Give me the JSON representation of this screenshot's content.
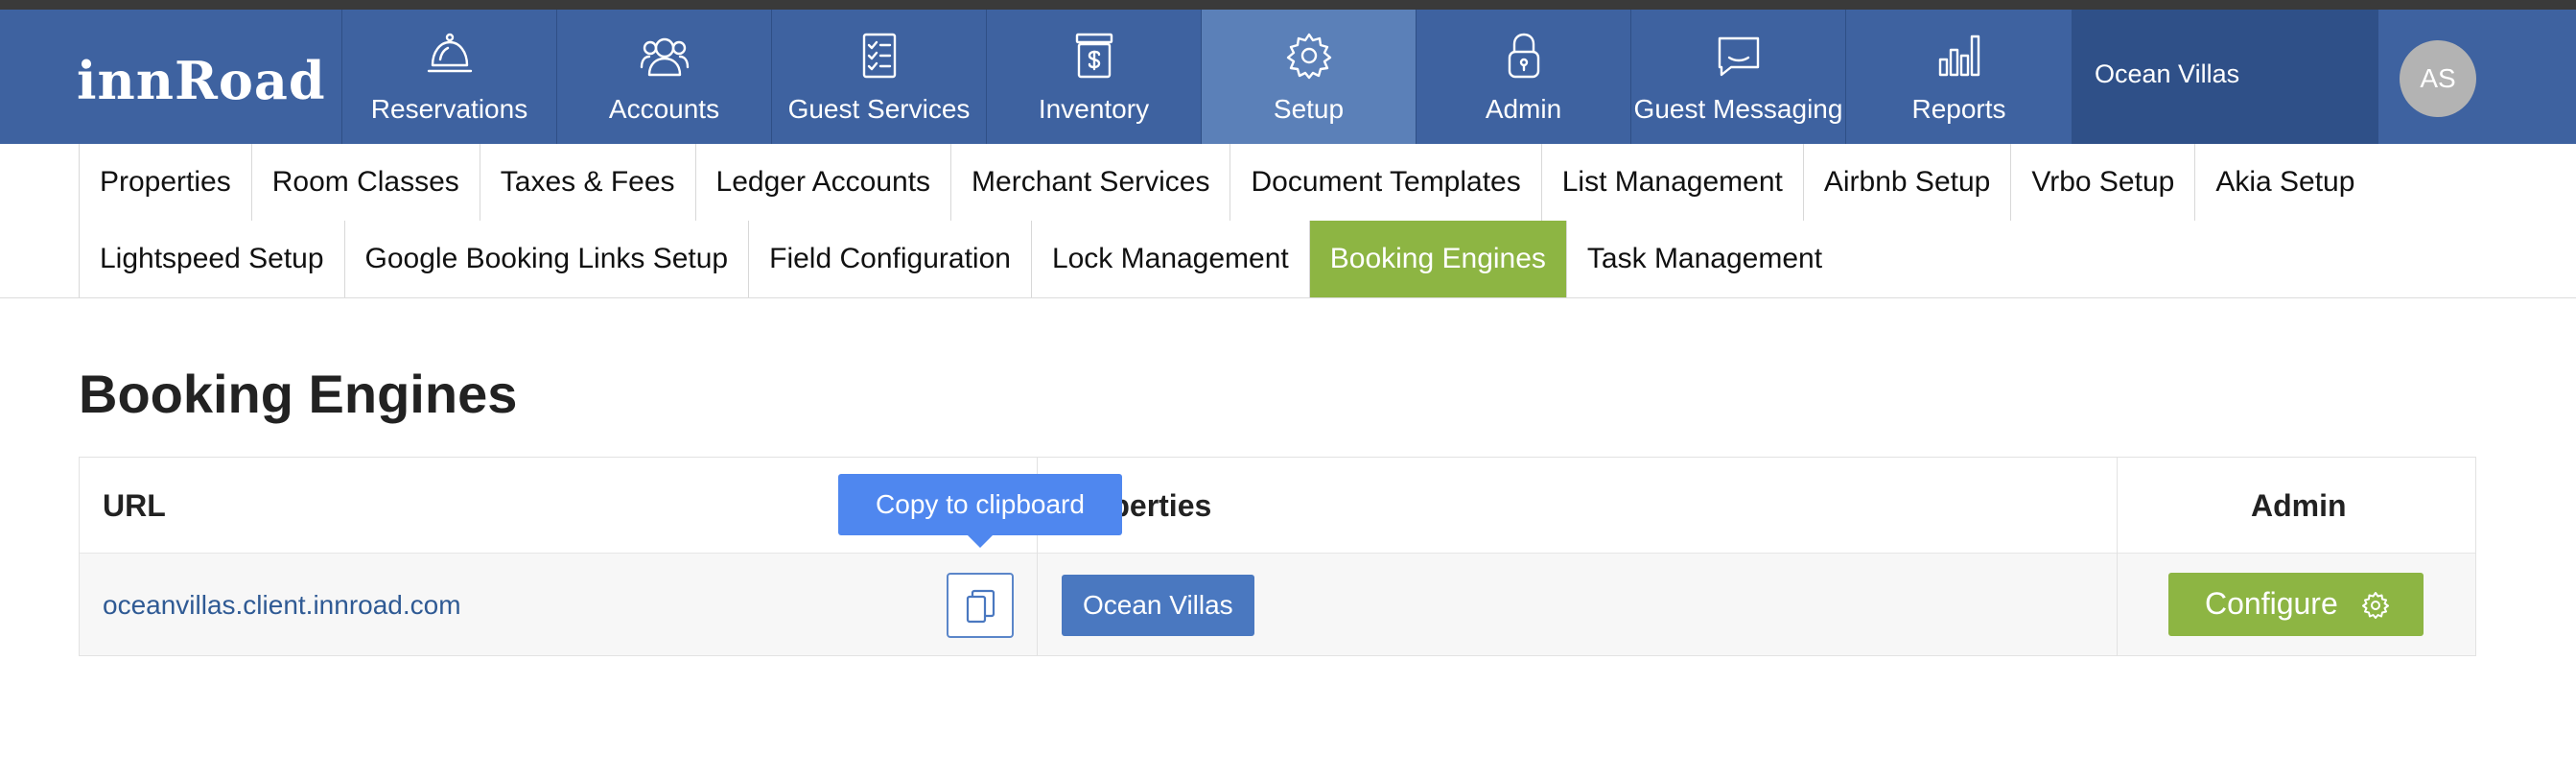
{
  "app": {
    "logo": "innRoad"
  },
  "nav": {
    "items": [
      {
        "label": "Reservations",
        "icon": "bell-icon"
      },
      {
        "label": "Accounts",
        "icon": "users-icon"
      },
      {
        "label": "Guest Services",
        "icon": "checklist-icon"
      },
      {
        "label": "Inventory",
        "icon": "inventory-icon"
      },
      {
        "label": "Setup",
        "icon": "gear-icon",
        "active": true
      },
      {
        "label": "Admin",
        "icon": "lock-icon"
      },
      {
        "label": "Guest Messaging",
        "icon": "message-icon"
      },
      {
        "label": "Reports",
        "icon": "bar-chart-icon"
      }
    ],
    "property": "Ocean Villas",
    "avatar": "AS"
  },
  "subnav": {
    "row1": [
      "Properties",
      "Room Classes",
      "Taxes & Fees",
      "Ledger Accounts",
      "Merchant Services",
      "Document Templates",
      "List Management",
      "Airbnb Setup",
      "Vrbo Setup",
      "Akia Setup"
    ],
    "row2": [
      "Lightspeed Setup",
      "Google Booking Links Setup",
      "Field Configuration",
      "Lock Management",
      "Booking Engines",
      "Task Management"
    ],
    "active": "Booking Engines"
  },
  "page": {
    "title": "Booking Engines"
  },
  "table": {
    "headers": {
      "url": "URL",
      "properties": "Properties",
      "admin": "Admin"
    },
    "rows": [
      {
        "url": "oceanvillas.client.innroad.com",
        "property": "Ocean Villas",
        "action": "Configure"
      }
    ]
  },
  "tooltip": {
    "text": "Copy to clipboard"
  },
  "colors": {
    "nav_bg": "#3e62a0",
    "nav_active": "#5b80b8",
    "accent_green": "#8db543",
    "badge_blue": "#4a78c0",
    "tooltip": "#4f87ef",
    "link": "#2f5a94"
  }
}
